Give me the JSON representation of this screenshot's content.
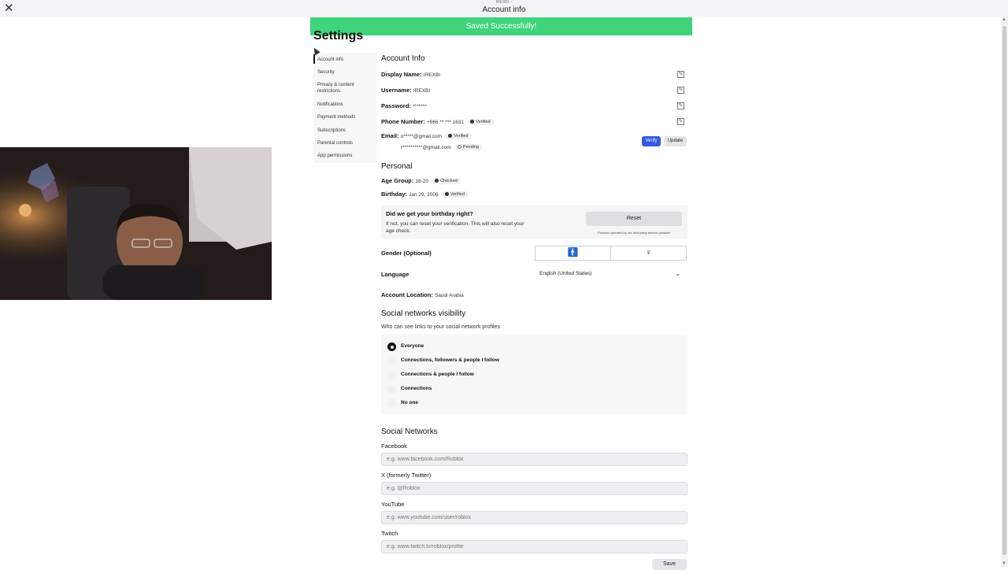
{
  "topbar": {
    "tiny_text": "IREXBI ~",
    "title": "Account info"
  },
  "toast": {
    "text": "Saved Successfully!"
  },
  "page": {
    "title": "Settings"
  },
  "sidebar": {
    "items": [
      {
        "label": "Account info"
      },
      {
        "label": "Security"
      },
      {
        "label": "Privacy & content restrictions"
      },
      {
        "label": "Notifications"
      },
      {
        "label": "Payment methods"
      },
      {
        "label": "Subscriptions"
      },
      {
        "label": "Parental controls"
      },
      {
        "label": "App permissions"
      }
    ]
  },
  "account_info": {
    "heading": "Account Info",
    "display_name_label": "Display Name:",
    "display_name_value": "IREXBI",
    "username_label": "Username:",
    "username_value": "IREXBI",
    "password_label": "Password:",
    "password_value": "*******",
    "phone_label": "Phone Number:",
    "phone_value": "+966 ** *** 1631",
    "phone_badge": "Verified",
    "email_label": "Email:",
    "email_1": "o*****@gmail.com",
    "email_1_badge": "Verified",
    "email_2": "r**********@gmail.com",
    "email_2_badge": "Pending",
    "verify_label": "Verify",
    "update_label": "Update"
  },
  "personal": {
    "heading": "Personal",
    "age_label": "Age Group:",
    "age_value": "18-20",
    "age_badge": "Checked",
    "birthday_label": "Birthday:",
    "birthday_value": "Jan 29, 2006",
    "birthday_badge": "Verified",
    "bday_question": "Did we get your birthday right?",
    "bday_desc": "If not, you can reset your verification. This will also reset your age check.",
    "reset_label": "Reset",
    "reset_note": "Process operated by our third party service provider",
    "gender_label": "Gender (Optional)",
    "gender_male_glyph": "🚹",
    "gender_female_glyph": "♀",
    "language_label": "Language",
    "language_value": "English (United States)",
    "location_label": "Account Location:",
    "location_value": "Saudi Arabia"
  },
  "social_visibility": {
    "heading": "Social networks visibility",
    "subtitle": "Who can see links to your social network profiles",
    "options": [
      {
        "label": "Everyone",
        "selected": true
      },
      {
        "label": "Connections, followers & people I follow",
        "selected": false
      },
      {
        "label": "Connections & people I follow",
        "selected": false
      },
      {
        "label": "Connections",
        "selected": false
      },
      {
        "label": "No one",
        "selected": false
      }
    ]
  },
  "social_networks": {
    "heading": "Social Networks",
    "fields": [
      {
        "label": "Facebook",
        "placeholder": "e.g. www.facebook.com/Roblox"
      },
      {
        "label": "X (formerly Twitter)",
        "placeholder": "e.g. @Roblox"
      },
      {
        "label": "YouTube",
        "placeholder": "e.g. www.youtube.com/user/roblox"
      },
      {
        "label": "Twitch",
        "placeholder": "e.g. www.twitch.tv/roblox/profile"
      }
    ],
    "save_label": "Save"
  },
  "icons": {
    "close": "close-icon",
    "edit": "edit-icon",
    "chevron": "chevron-down-icon"
  },
  "colors": {
    "toast_green": "#3fd37c",
    "verify_blue": "#3359e6"
  }
}
